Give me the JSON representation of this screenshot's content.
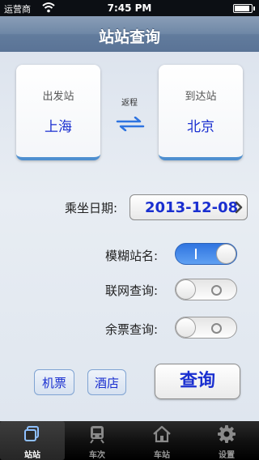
{
  "status_bar": {
    "carrier": "运营商",
    "time": "7:45 PM"
  },
  "nav": {
    "title": "站站查询"
  },
  "stations": {
    "from_label": "出发站",
    "from_value": "上海",
    "to_label": "到达站",
    "to_value": "北京",
    "return_label": "返程"
  },
  "date": {
    "label": "乘坐日期:",
    "value": "2013-12-08"
  },
  "options": {
    "fuzzy_label": "模糊站名:",
    "fuzzy_on": true,
    "network_label": "联网查询:",
    "network_on": false,
    "remaining_label": "余票查询:",
    "remaining_on": false
  },
  "buttons": {
    "flight": "机票",
    "hotel": "酒店",
    "query": "查询"
  },
  "tabs": [
    {
      "label": "站站",
      "icon": "station-to-station-icon",
      "active": true
    },
    {
      "label": "车次",
      "icon": "train-icon",
      "active": false
    },
    {
      "label": "车站",
      "icon": "home-icon",
      "active": false
    },
    {
      "label": "设置",
      "icon": "gear-icon",
      "active": false
    }
  ],
  "colors": {
    "accent_blue": "#1a2fd0",
    "toggle_on": "#2f74e0",
    "nav_bar": "#6e87a6"
  }
}
